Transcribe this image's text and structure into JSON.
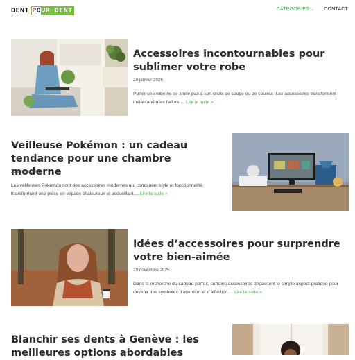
{
  "header": {
    "logo_part1": "DENT",
    "logo_part2_pre": "PO",
    "logo_part2_hl": "UR DENT",
    "nav": {
      "categories": "CATÉGORIES",
      "contact": "CONTACT"
    }
  },
  "articles": [
    {
      "title": "Accessoires incontournables pour sublimer votre robe",
      "date": "29 janvier 2026",
      "excerpt": "Porter une robe ne se limite pas à son choix de coupe ou de couleur. Les accessoires transforment instantanément l'allure,...",
      "more": "Lire la suite »"
    },
    {
      "title": "Veilleuse Pokémon : un cadeau tendance pour une chambre moderne",
      "date": "25 janvier 2026",
      "excerpt": "Les veilleuses Pokémon sont des accessoires modernes qui combinent style et fonctionnalité, transformant une pièce en espace chaleureux et accueillant....",
      "more": "Lire la suite »"
    },
    {
      "title": "Idées d’accessoires pour surprendre votre bien-aimée",
      "date": "29 novembre 2025",
      "excerpt": "Dans la recherche du cadeau parfait, certains accessoires dépassent le simple aspect pratique pour devenir des symboles d'attention et d'affection....",
      "more": "Lire la suite »"
    },
    {
      "title": "Blanchir ses dents à Genève : les meilleures options abordables",
      "date": "",
      "excerpt": "",
      "more": ""
    }
  ],
  "colors": {
    "accent": "#46a84a",
    "logo_green": "#7ac142",
    "title": "#2b2b2b"
  }
}
